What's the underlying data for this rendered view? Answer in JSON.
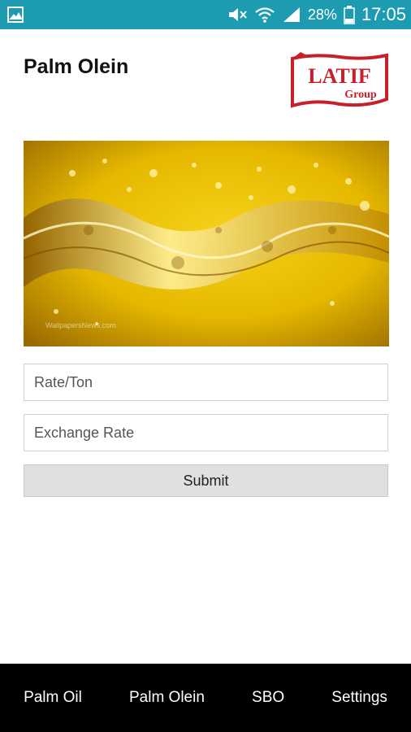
{
  "status_bar": {
    "battery_percent": "28%",
    "time": "17:05",
    "icons": [
      "gallery-icon",
      "mute-icon",
      "wifi-icon",
      "signal-icon",
      "battery-icon"
    ]
  },
  "header": {
    "title": "Palm Olein",
    "logo_text": "LATIF",
    "logo_subtext": "Group"
  },
  "hero": {
    "credit": "WallpapersNews.com"
  },
  "form": {
    "rate_placeholder": "Rate/Ton",
    "exchange_placeholder": "Exchange Rate",
    "submit_label": "Submit"
  },
  "bottom_nav": {
    "items": [
      {
        "label": "Palm Oil"
      },
      {
        "label": "Palm Olein"
      },
      {
        "label": "SBO"
      },
      {
        "label": "Settings"
      }
    ]
  },
  "colors": {
    "status_bar": "#1c9bb1",
    "logo_red": "#c8202b",
    "nav_background": "#000000",
    "button_background": "#e0e0e0"
  }
}
